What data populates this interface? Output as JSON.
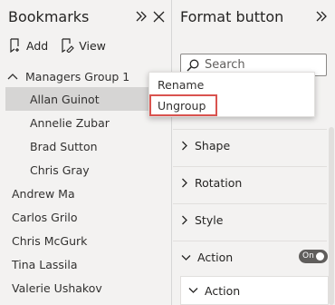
{
  "bookmarks_pane": {
    "title": "Bookmarks",
    "expand_icon": "double-chevron-right-icon",
    "close_icon": "close-icon",
    "toolbar": {
      "add_label": "Add",
      "view_label": "View"
    },
    "group": {
      "name": "Managers Group 1",
      "expanded": true,
      "children": [
        "Allan Guinot",
        "Annelie Zubar",
        "Brad Sutton",
        "Chris Gray"
      ],
      "selected": "Allan Guinot"
    },
    "items": [
      "Andrew Ma",
      "Carlos Grilo",
      "Chris McGurk",
      "Tina Lassila",
      "Valerie Ushakov"
    ]
  },
  "format_pane": {
    "title": "Format button",
    "search_placeholder": "Search",
    "sections": [
      "Shape",
      "Rotation",
      "Style",
      "Action"
    ],
    "action_toggle": "On",
    "subsection": "Action"
  },
  "context_menu": {
    "items": [
      "Rename",
      "Ungroup"
    ],
    "highlighted": "Ungroup"
  },
  "colors": {
    "highlight_border": "#d9534f",
    "selected_row": "#d6d5d4",
    "toggle_on": "#605e5c"
  }
}
